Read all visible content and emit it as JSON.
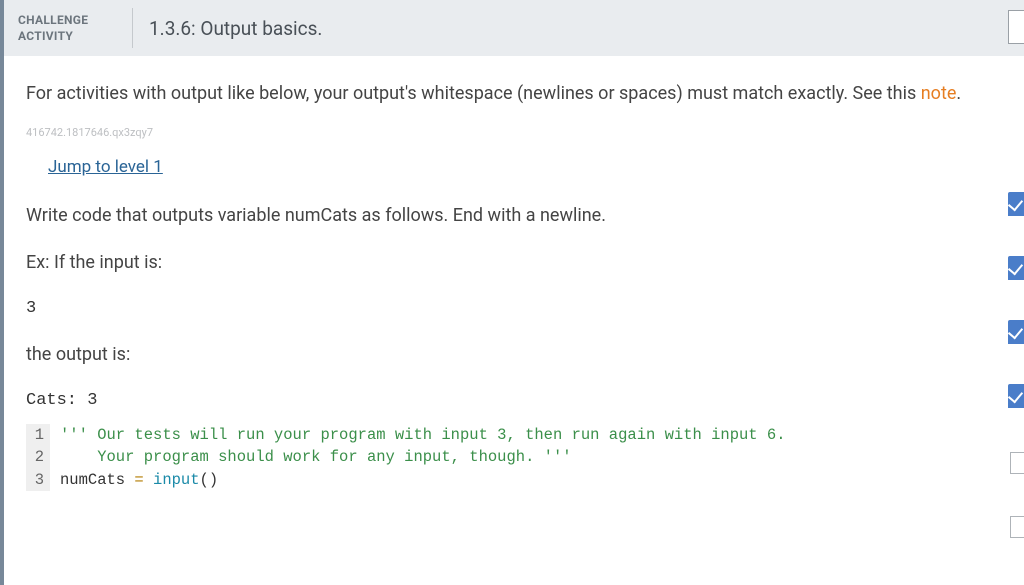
{
  "header": {
    "label_line1": "CHALLENGE",
    "label_line2": "ACTIVITY",
    "title": "1.3.6: Output basics."
  },
  "intro": {
    "text_prefix": "For activities with output like below, your output's whitespace (newlines or spaces) must match exactly. See this ",
    "note_word": "note",
    "text_suffix": "."
  },
  "meta_id": "416742.1817646.qx3zqy7",
  "jump_link": "Jump to level 1",
  "prompt": "Write code that outputs variable numCats as follows. End with a newline.",
  "example_label": "Ex: If the input is:",
  "example_input": "3",
  "output_label": "the output is:",
  "example_output": "Cats: 3",
  "code": {
    "lines": [
      {
        "n": "1",
        "comment": "''' Our tests will run your program with input 3, then run again with input 6."
      },
      {
        "n": "2",
        "comment": "    Your program should work for any input, though. '''"
      },
      {
        "n": "3",
        "var": "numCats",
        "op": " = ",
        "fn": "input",
        "paren": "()"
      }
    ]
  }
}
